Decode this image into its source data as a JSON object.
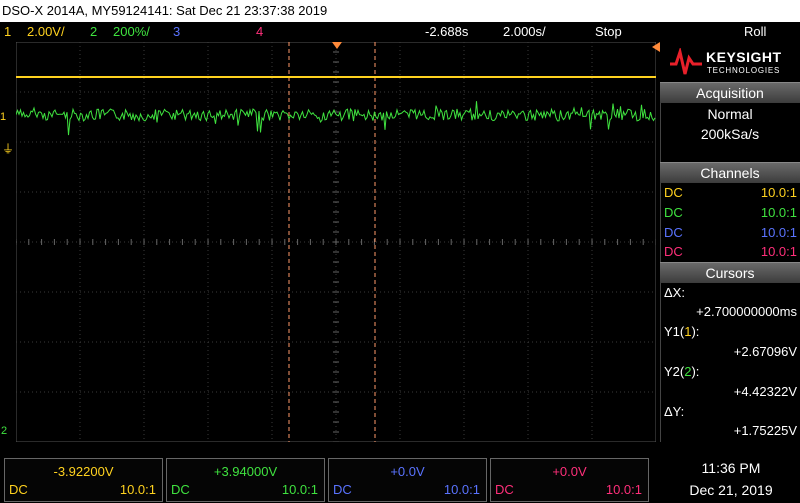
{
  "title": "DSO-X 2014A, MY59124141: Sat Dec 21 23:37:38 2019",
  "status": {
    "ch1_num": "1",
    "ch1_scale": "2.00V/",
    "ch2_num": "2",
    "ch2_scale": "200%/",
    "ch3_num": "3",
    "ch4_num": "4",
    "time_offset": "-2.688s",
    "time_scale": "2.000s/",
    "run_state": "Stop",
    "mode": "Roll"
  },
  "brand": {
    "name": "KEYSIGHT",
    "sub": "TECHNOLOGIES"
  },
  "acquisition": {
    "heading": "Acquisition",
    "mode": "Normal",
    "rate": "200kSa/s"
  },
  "channels": {
    "heading": "Channels",
    "items": [
      {
        "coupling": "DC",
        "probe": "10.0:1",
        "color": "#ffd21f"
      },
      {
        "coupling": "DC",
        "probe": "10.0:1",
        "color": "#3fe23f"
      },
      {
        "coupling": "DC",
        "probe": "10.0:1",
        "color": "#5a73ff"
      },
      {
        "coupling": "DC",
        "probe": "10.0:1",
        "color": "#ff2f7a"
      }
    ]
  },
  "cursors": {
    "heading": "Cursors",
    "dx_label": "ΔX:",
    "dx_value": "+2.700000000ms",
    "y1_label_pre": "Y1(",
    "y1_label_ch": "1",
    "y1_label_post": "):",
    "y1_value": "+2.67096V",
    "y2_label_pre": "Y2(",
    "y2_label_ch": "2",
    "y2_label_post": "):",
    "y2_value": "+4.42322V",
    "dy_label": "ΔY:",
    "dy_value": "+1.75225V"
  },
  "bottom": [
    {
      "value": "-3.92200V",
      "coupling": "DC",
      "probe": "10.0:1",
      "color": "#ffd21f"
    },
    {
      "value": "+3.94000V",
      "coupling": "DC",
      "probe": "10.0:1",
      "color": "#3fe23f"
    },
    {
      "value": "+0.0V",
      "coupling": "DC",
      "probe": "10.0:1",
      "color": "#5a73ff"
    },
    {
      "value": "+0.0V",
      "coupling": "DC",
      "probe": "10.0:1",
      "color": "#ff2f7a"
    }
  ],
  "clock": {
    "time": "11:36 PM",
    "date": "Dec 21, 2019"
  },
  "markers": {
    "ch1": "1",
    "ch2": "2"
  }
}
